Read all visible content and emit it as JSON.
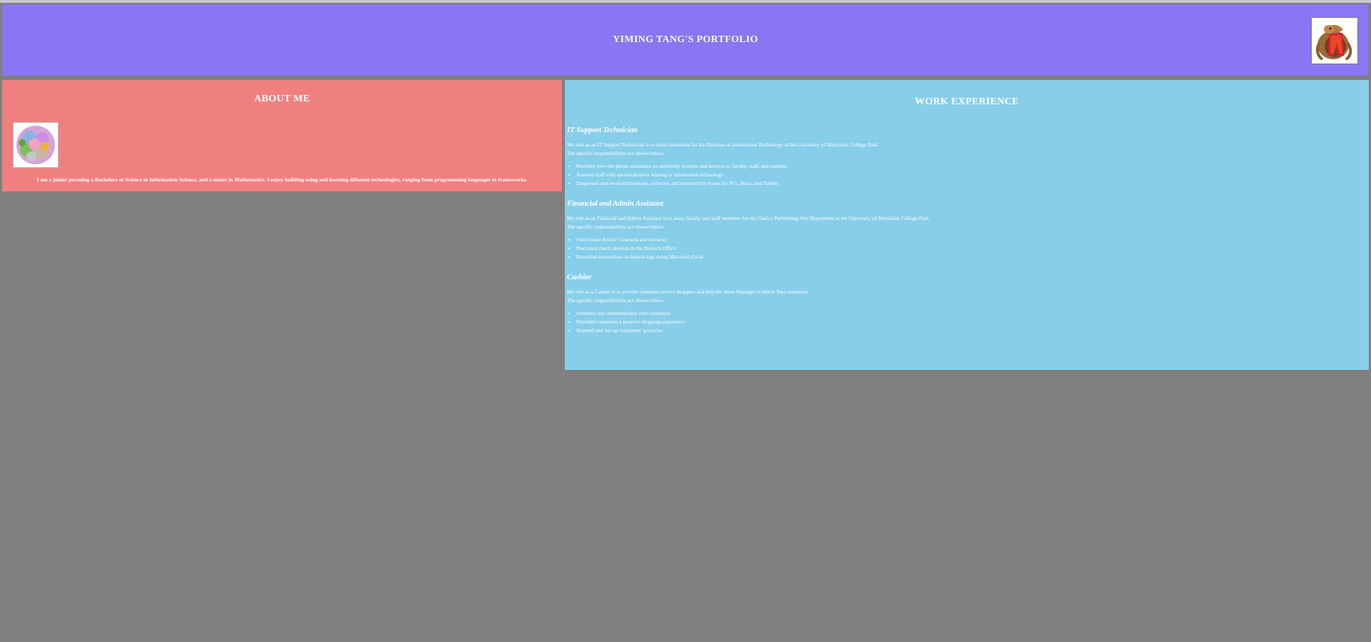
{
  "header": {
    "title": "YIMING TANG'S PORTFOLIO",
    "logo_alt": "University of Maryland Testudo logo",
    "logo_icon": "testudo-icon"
  },
  "about": {
    "title": "ABOUT ME",
    "avatar_icon": "avatar-icon",
    "text": "I am a junior pursuing a Bachelors of Science in Information Science, and a minor in Mathematics. I enjoy building using and learning different technologies, ranging from programming languages to frameworks."
  },
  "work": {
    "title": "WORK EXPERIENCE",
    "jobs": [
      {
        "title": "IT Support Technician",
        "line1": "My role as an IT Support Technician is to assist customers for the Division of Information Technology at the University of Maryland, College Park.",
        "line2": "The specific responsibilities are shown below.",
        "items": [
          "Provided over-the-phone assistance on university systems and services to faculty, staff, and students",
          "Assisted staff with special projects relating to information technology",
          "Diagnosed and resolved hardware, software, and connectivity issues for PCs, Macs, and Tablets"
        ]
      },
      {
        "title": "Financial and Admin Assistant",
        "line1": "My role as an Financial and Admin Assistant is to assist faculty and staff members for the Clarice Performing Arts Department at the University of Maryland, College Park.",
        "line2": "The specific responsibilities are shown below.",
        "items": [
          "Filed Guest Artists' Contracts and Invoices",
          "Processed check deposits in the Bursar's Office",
          "Recorded transactions in deposit logs using Microsoft Excel"
        ]
      },
      {
        "title": "Cashier",
        "line1": "My role as a Cashier is to provide customer service shoppers and help the Store Manager in Harris Teet customers.",
        "line2": "The specific responsibilities are shown below.",
        "items": [
          "Attended and communicated with customers",
          "Provided customers a positive shopping experience",
          "Scanned and run up customers' groceries"
        ]
      }
    ]
  },
  "colors": {
    "background": "#808080",
    "header": "#8a76f2",
    "about": "#f08080",
    "work": "#87ceeb",
    "text": "#ffffff"
  }
}
